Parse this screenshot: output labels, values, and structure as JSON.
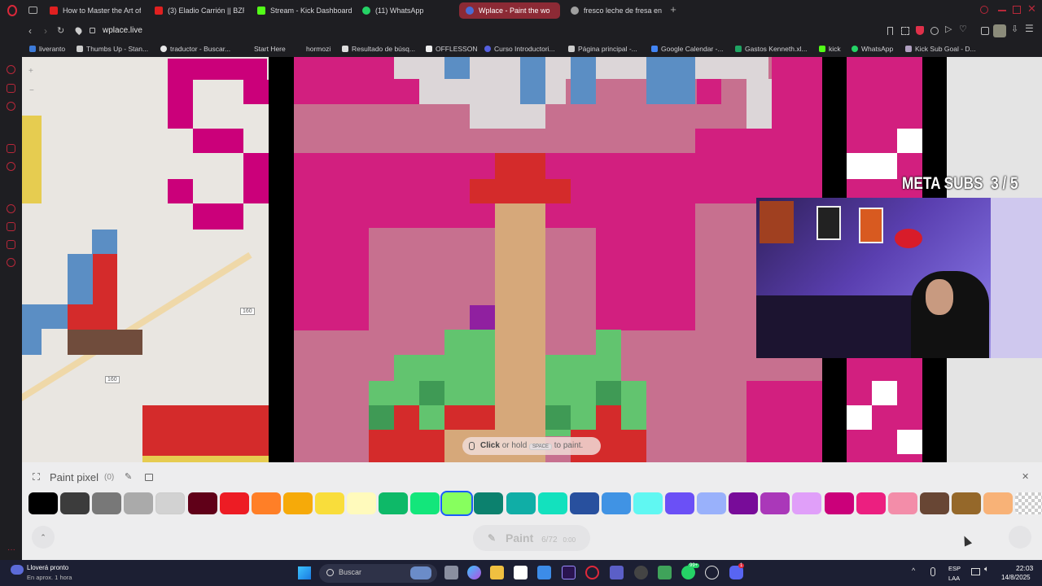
{
  "browser": {
    "tabs": [
      {
        "title": "How to Master the Art of",
        "color": "#e02020"
      },
      {
        "title": "(3) Eladio Carrión || BZRP",
        "color": "#e02020"
      },
      {
        "title": "Stream - Kick Dashboard",
        "color": "#53fc18"
      },
      {
        "title": "(11) WhatsApp",
        "color": "#25d366"
      },
      {
        "title": "Wplace - Paint the wo",
        "color": "#4a6cd4"
      },
      {
        "title": "fresco leche de fresa en",
        "color": "#a0a0a0"
      }
    ],
    "url": "wplace.live",
    "bookmarks": [
      "liveranto",
      "Thumbs Up - Stan...",
      "traductor - Buscar...",
      "Start Here",
      "hormozi",
      "Resultado de búsq...",
      "OFFLESSON",
      "Curso Introductori...",
      "Página principal -...",
      "Google Calendar -...",
      "Gastos Kenneth.xl...",
      "kick",
      "WhatsApp",
      "Kick Sub Goal - D..."
    ]
  },
  "canvas": {
    "road_label_1": "160",
    "road_label_2": "160",
    "paint_hint_click": "Click",
    "paint_hint_mid": "or hold",
    "paint_hint_key": "SPACE",
    "paint_hint_end": "to paint."
  },
  "overlay": {
    "meta_label": "META SUBS  3 / 5"
  },
  "panel": {
    "title": "Paint pixel",
    "count": "(0)",
    "paint_button": "Paint",
    "paint_count": "6/72",
    "paint_timer": "0:00",
    "palette": [
      "#000000",
      "#3c3c3c",
      "#787878",
      "#aaaaaa",
      "#d2d2d2",
      "#600018",
      "#ed1c24",
      "#ff7f27",
      "#f6aa09",
      "#f9dd3b",
      "#fffabc",
      "#0eb968",
      "#13e67b",
      "#87ff5e",
      "#0c816e",
      "#10aea6",
      "#13e1be",
      "#28509e",
      "#4093e4",
      "#60f7f2",
      "#6b50f6",
      "#99b1fb",
      "#780c99",
      "#aa38b9",
      "#e09ff9",
      "#cb007a",
      "#ec1f80",
      "#f38da9",
      "#684634",
      "#95682a",
      "#f8b277"
    ],
    "selected_index": 13
  },
  "taskbar": {
    "weather_title": "Lloverá pronto",
    "weather_sub": "En aprox. 1 hora",
    "search_placeholder": "Buscar",
    "lang_1": "ESP",
    "lang_2": "LAA",
    "time": "22:03",
    "date": "14/8/2025",
    "badge_whatsapp": "99+",
    "badge_discord": "1"
  }
}
